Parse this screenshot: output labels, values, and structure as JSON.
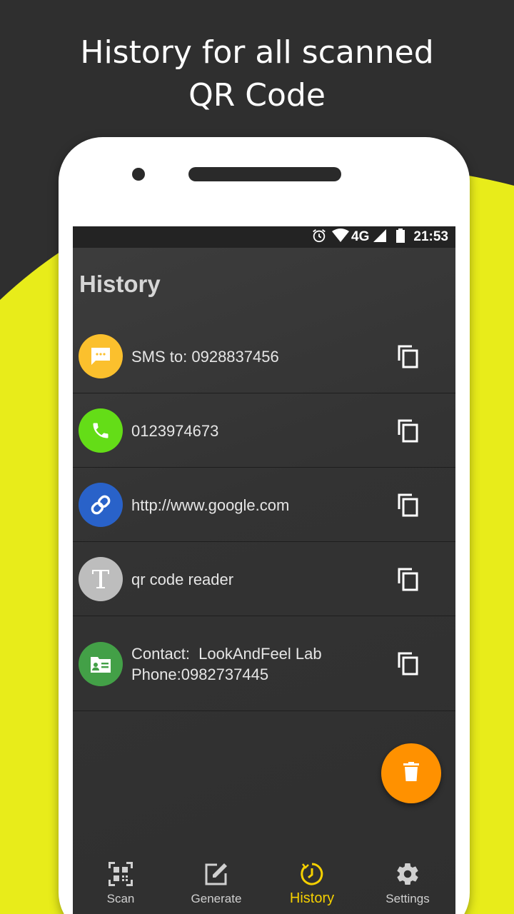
{
  "promo": {
    "line1": "History for all scanned",
    "line2": "QR Code",
    "accent_color": "#e8ec1a",
    "background_color": "#2f2f2f"
  },
  "status_bar": {
    "icons": [
      "alarm-icon",
      "wifi-icon",
      "signal-icon",
      "battery-icon"
    ],
    "network": "4G",
    "time": "21:53"
  },
  "screen": {
    "title": "History"
  },
  "history": {
    "items": [
      {
        "type": "sms",
        "icon": "message-icon",
        "color": "#fbc02d",
        "text": "SMS to: 0928837456"
      },
      {
        "type": "phone",
        "icon": "phone-icon",
        "color": "#64dd17",
        "text": "0123974673"
      },
      {
        "type": "url",
        "icon": "link-icon",
        "color": "#2962c9",
        "text": "http://www.google.com"
      },
      {
        "type": "text",
        "icon": "text-icon",
        "color": "#bdbdbd",
        "text": "qr code reader"
      },
      {
        "type": "contact",
        "icon": "contact-card-icon",
        "color": "#43a047",
        "line1": "Contact:  LookAndFeel Lab",
        "line2": "Phone:0982737445"
      }
    ],
    "copy_icon": "copy-icon"
  },
  "fab": {
    "icon": "trash-icon",
    "color": "#ff9100"
  },
  "nav": {
    "items": [
      {
        "label": "Scan",
        "icon": "qr-code-icon"
      },
      {
        "label": "Generate",
        "icon": "edit-icon"
      },
      {
        "label": "History",
        "icon": "clock-icon",
        "active": true,
        "active_color": "#f5d000"
      },
      {
        "label": "Settings",
        "icon": "gear-icon"
      }
    ]
  }
}
